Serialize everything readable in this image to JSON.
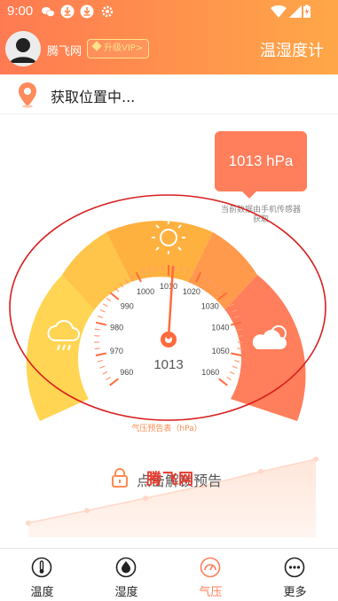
{
  "status_bar": {
    "time": "9:00"
  },
  "header": {
    "username": "腾飞网",
    "vip_label": "升级VIP>",
    "title": "温湿度计"
  },
  "location": {
    "text": "获取位置中..."
  },
  "pressure_bubble": {
    "value": "1013 hPa",
    "note": "当前数据由手机传感器获取"
  },
  "gauge": {
    "ticks": [
      "960",
      "970",
      "980",
      "990",
      "1000",
      "1010",
      "1020",
      "1030",
      "1040",
      "1050",
      "1060"
    ],
    "reading": "1013",
    "caption": "气压预告表（hPa）",
    "colors": {
      "left": "#ffd350",
      "mid": "#ffb13f",
      "right": "#ff7e5b"
    }
  },
  "forecast": {
    "lock_label": "点击解锁预告",
    "watermark": "腾飞网"
  },
  "nav": {
    "items": [
      {
        "label": "温度",
        "icon": "thermometer-icon"
      },
      {
        "label": "湿度",
        "icon": "droplet-icon"
      },
      {
        "label": "气压",
        "icon": "gauge-icon",
        "active": true
      },
      {
        "label": "更多",
        "icon": "more-icon"
      }
    ]
  },
  "accent": "#ff7e5b"
}
